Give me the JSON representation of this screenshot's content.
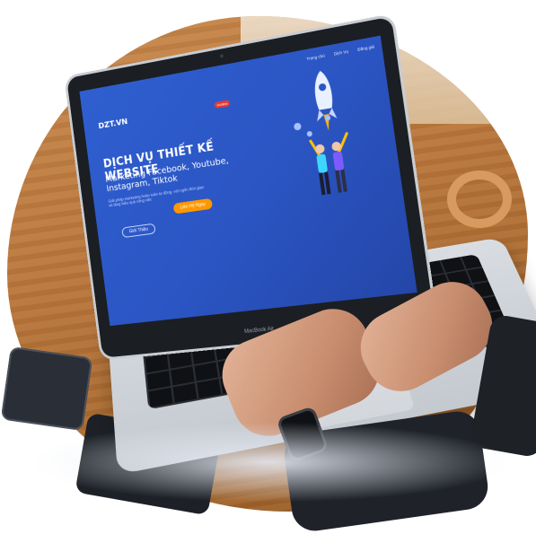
{
  "screen": {
    "nav": [
      "Trang chủ",
      "Dịch Vụ",
      "Đăng giá"
    ],
    "logo": "DZT.VN",
    "badge": "Hotline",
    "headline": "DỊCH VỤ THIẾT KẾ WEBSITE",
    "subheadline": "Marketing Facebook, Youtube, Instagram, Tiktok",
    "description": "Giải pháp marketing hoàn toàn tự động, với ngôn thời gian và tăng hiệu quả công việc",
    "cta_primary": "Liên Hệ Ngay",
    "cta_secondary": "Giới Thiệu",
    "laptop_brand": "MacBook Air"
  },
  "colors": {
    "screen_blue": "#2b55c3",
    "accent_orange": "#ff9800",
    "badge_red": "#e53935",
    "table_wood": "#b8763c"
  }
}
